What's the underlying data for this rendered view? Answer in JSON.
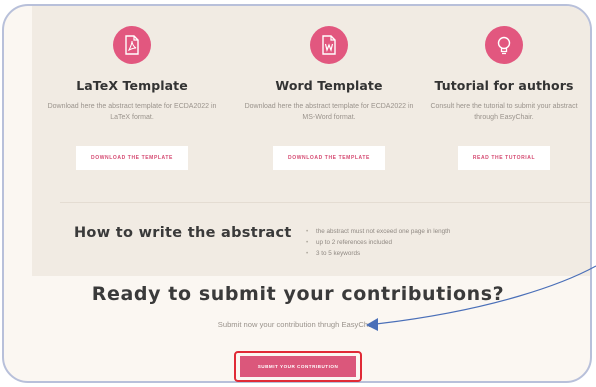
{
  "templates": [
    {
      "title": "LaTeX Template",
      "desc": "Download here the abstract template for ECDA2022 in LaTeX format.",
      "button": "DOWNLOAD THE TEMPLATE",
      "icon": "pdf-file-icon"
    },
    {
      "title": "Word Template",
      "desc": "Download here the abstract template for ECDA2022 in MS-Word format.",
      "button": "DOWNLOAD THE TEMPLATE",
      "icon": "word-file-icon"
    },
    {
      "title": "Tutorial for authors",
      "desc": "Consult here the tutorial to submit your abstract through EasyChair.",
      "button": "READ THE TUTORIAL",
      "icon": "lightbulb-icon"
    }
  ],
  "howto": {
    "title": "How to write the abstract",
    "rules": [
      "the abstract must not exceed one page in length",
      "up to 2 references included",
      "3 to 5 keywords"
    ]
  },
  "submit": {
    "heading": "Ready to submit your contributions?",
    "text": "Submit now your contribution thrugh EasyChair.",
    "button": "SUBMIT YOUR CONTRIBUTION"
  },
  "colors": {
    "accent": "#e2577f",
    "highlight_border": "#e02a36",
    "arrow": "#4a6fb8"
  }
}
